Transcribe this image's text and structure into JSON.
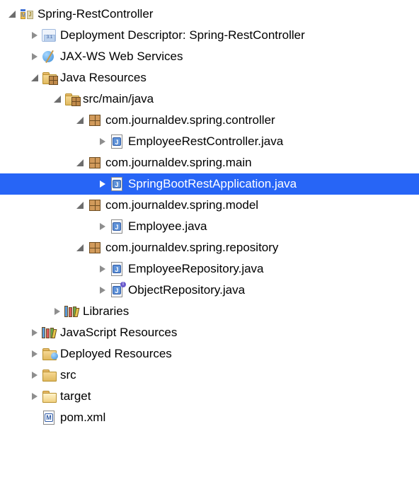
{
  "tree": {
    "project": "Spring-RestController",
    "deploymentDescriptor": "Deployment Descriptor: Spring-RestController",
    "jaxws": "JAX-WS Web Services",
    "javaResources": "Java Resources",
    "srcMainJava": "src/main/java",
    "packages": {
      "controller": "com.journaldev.spring.controller",
      "main": "com.journaldev.spring.main",
      "model": "com.journaldev.spring.model",
      "repository": "com.journaldev.spring.repository"
    },
    "files": {
      "employeeRestController": "EmployeeRestController.java",
      "springBootRestApplication": "SpringBootRestApplication.java",
      "employee": "Employee.java",
      "employeeRepository": "EmployeeRepository.java",
      "objectRepository": "ObjectRepository.java",
      "pomXml": "pom.xml"
    },
    "libraries": "Libraries",
    "jsResources": "JavaScript Resources",
    "deployedResources": "Deployed Resources",
    "srcFolder": "src",
    "targetFolder": "target"
  }
}
